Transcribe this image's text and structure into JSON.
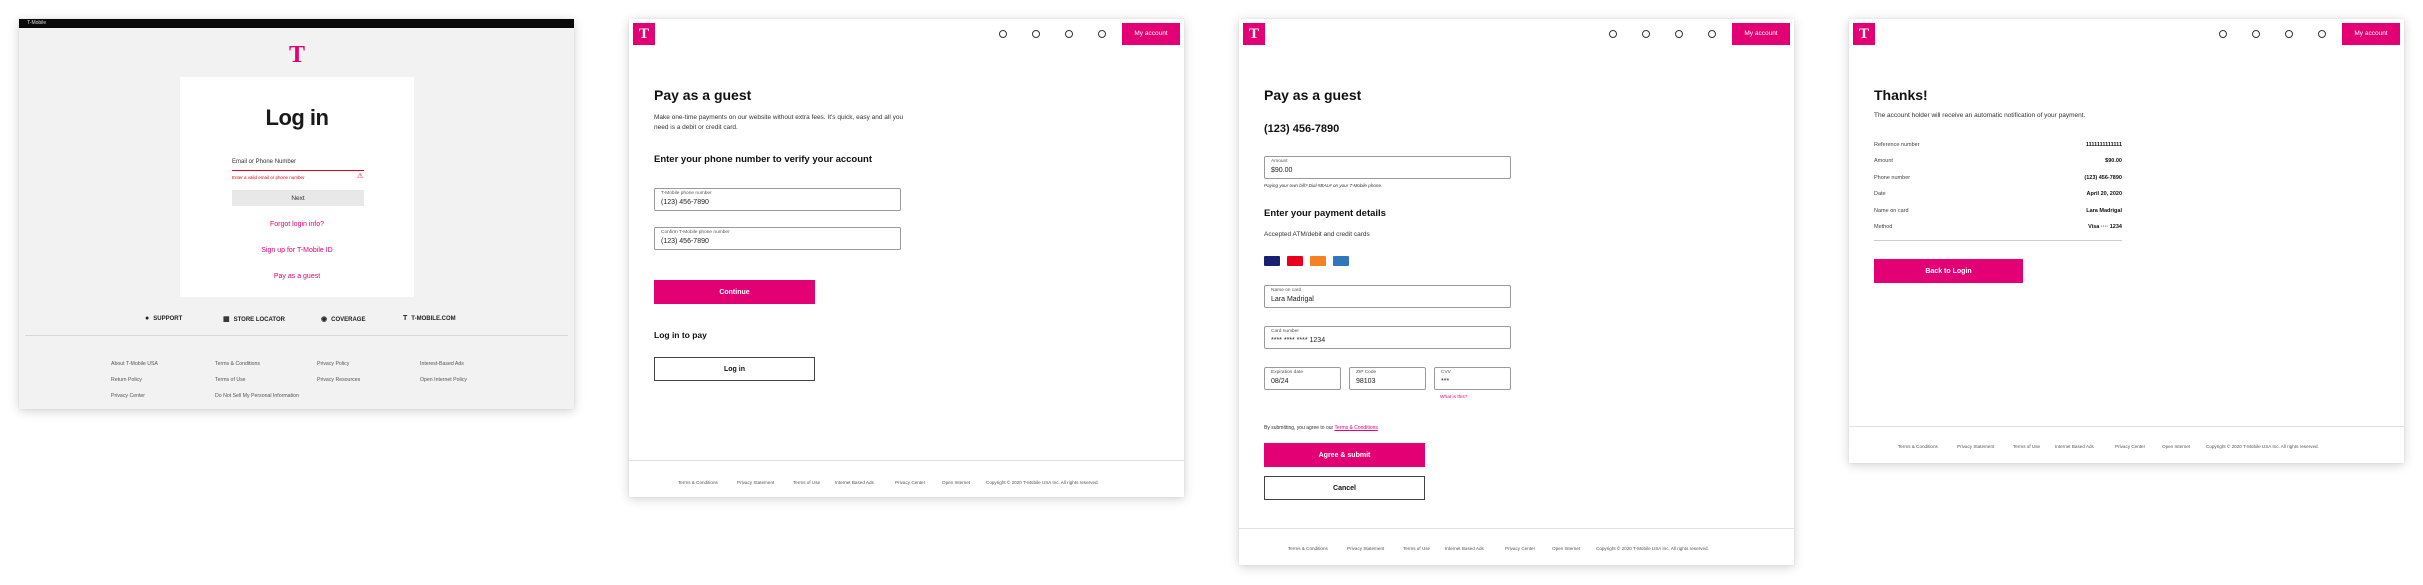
{
  "brand": {
    "logo_glyph": "T",
    "accent": "#e20074"
  },
  "login_screen": {
    "topbar_text": "T-Mobile",
    "title": "Log in",
    "field_label": "Email or Phone Number",
    "error_text": "Enter a valid email or phone number",
    "next_label": "Next",
    "links": [
      "Forgot login info?",
      "Sign up for T-Mobile ID",
      "Pay as a guest"
    ],
    "utility_links": [
      {
        "icon": "support-icon",
        "glyph": "●",
        "label": "SUPPORT"
      },
      {
        "icon": "store-icon",
        "glyph": "▦",
        "label": "STORE LOCATOR"
      },
      {
        "icon": "signal-icon",
        "glyph": "◉",
        "label": "COVERAGE"
      },
      {
        "icon": "tmobile-icon",
        "glyph": "T",
        "label": "T-MOBILE.COM"
      }
    ],
    "footer_columns": [
      [
        "About T-Mobile USA",
        "Return Policy",
        "Privacy Center"
      ],
      [
        "Terms & Conditions",
        "Terms of Use",
        "Do Not Sell My Personal Information"
      ],
      [
        "Privacy Policy",
        "Privacy Resources"
      ],
      [
        "Interest-Based Ads",
        "Open Internet Policy"
      ]
    ]
  },
  "header": {
    "account_label": "My account"
  },
  "guest_screen": {
    "title": "Pay as a guest",
    "intro": "Make one-time payments on our website without extra fees. It's quick, easy and all you need is a debit or credit card.",
    "verify_heading": "Enter your phone number to verify your account",
    "phone_label": "T-Mobile phone number",
    "phone_value": "(123) 456-7890",
    "confirm_label": "Confirm T-Mobile phone number",
    "confirm_value": "(123) 456-7890",
    "continue_label": "Continue",
    "login_heading": "Log in to pay",
    "login_label": "Log in"
  },
  "payment_screen": {
    "title": "Pay as a guest",
    "phone": "(123) 456-7890",
    "amount_label": "Amount",
    "amount_value": "$90.00",
    "amount_note": "Paying your own bill? Dial #BAL# on your T-Mobile phone.",
    "details_heading": "Enter your payment details",
    "accepted_text": "Accepted ATM/debit and credit cards",
    "card_brands": [
      {
        "name": "Visa",
        "color": "#1a1f71"
      },
      {
        "name": "Mastercard",
        "color": "#eb001b"
      },
      {
        "name": "Discover",
        "color": "#f58220"
      },
      {
        "name": "Amex",
        "color": "#2e77bc"
      }
    ],
    "name_label": "Name on card",
    "name_value": "Lara Madrigal",
    "card_label": "Card number",
    "card_value": "**** **** **** 1234",
    "exp_label": "Expiration date",
    "exp_value": "08/24",
    "zip_label": "ZIP Code",
    "zip_value": "98103",
    "cvv_label": "CVV",
    "cvv_value": "***",
    "cvv_help": "What is this?",
    "agree_text": "By submitting, you agree to our",
    "agree_link": "Terms & Conditions",
    "submit_label": "Agree & submit",
    "cancel_label": "Cancel"
  },
  "thanks_screen": {
    "title": "Thanks!",
    "message": "The account holder will receive an automatic notification of your payment.",
    "rows": [
      {
        "label": "Reference number",
        "value": "1111111111111"
      },
      {
        "label": "Amount",
        "value": "$90.00"
      },
      {
        "label": "Phone number",
        "value": "(123) 456-7890"
      },
      {
        "label": "Date",
        "value": "April 20, 2020"
      },
      {
        "label": "Name on card",
        "value": "Lara Madrigal"
      },
      {
        "label": "Method",
        "value": "Visa ···· 1234"
      }
    ],
    "back_label": "Back to Login"
  },
  "footer_links": [
    "Terms & Conditions",
    "Privacy Statement",
    "Terms of Use",
    "Internet Based Ads",
    "Privacy Center",
    "Open Internet",
    "Copyright © 2020 T-Mobile USA Inc. All rights reserved."
  ]
}
